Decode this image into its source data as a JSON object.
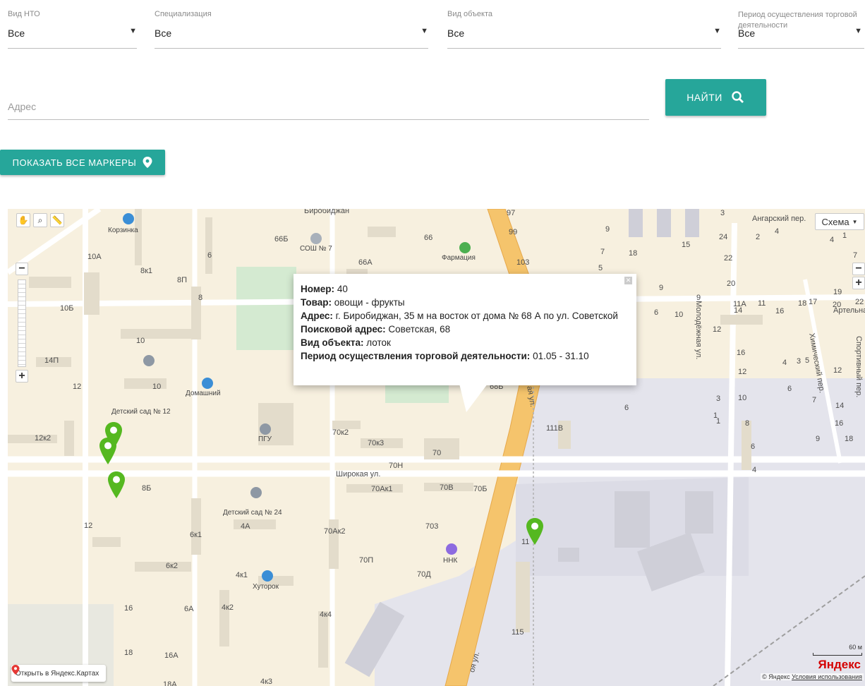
{
  "filters": [
    {
      "label": "Вид НТО",
      "value": "Все"
    },
    {
      "label": "Специализация",
      "value": "Все"
    },
    {
      "label": "Вид объекта",
      "value": "Все"
    },
    {
      "label": "Период осуществления торговой деятельности",
      "value": "Все"
    }
  ],
  "search": {
    "placeholder": "Адрес",
    "button_label": "НАЙТИ"
  },
  "show_markers_label": "ПОКАЗАТЬ ВСЕ МАРКЕРЫ",
  "map": {
    "type_selector": "Схема",
    "open_in_yandex": "Открыть в Яндекс.Картах",
    "logo": "Яндекс",
    "copyright": "© Яндекс",
    "terms": "Условия использования",
    "scale": "60 м",
    "balloon": {
      "number_label": "Номер:",
      "number": "40",
      "goods_label": "Товар:",
      "goods": "овощи - фрукты",
      "address_label": "Адрес:",
      "address": "г. Биробиджан, 35 м на восток от дома № 68 А по ул. Советской",
      "search_label": "Поисковой адрес:",
      "search_address": "Советская, 68",
      "object_label": "Вид объекта:",
      "object": "лоток",
      "period_label": "Период осуществления торговой деятельности:",
      "period": "01.05 - 31.10"
    },
    "pois": [
      "Корзинка",
      "СОШ № 7",
      "Фармация",
      "Домашний",
      "Детский сад № 12",
      "ПГУ",
      "Детский сад № 24",
      "ННК",
      "Хуторок"
    ],
    "streets": [
      "Широкая ул.",
      "Ангарский пер.",
      "Молодёжная ул.",
      "Химический пер.",
      "Спортивный пер.",
      "Артельная",
      "Биробиджан",
      "ая ул.",
      "оя ул."
    ],
    "house_numbers": [
      "66Б",
      "66",
      "66А",
      "97",
      "99",
      "103",
      "9",
      "7",
      "5",
      "18",
      "15",
      "24",
      "3",
      "2",
      "4",
      "4",
      "1",
      "5",
      "7",
      "10А",
      "8к1",
      "8П",
      "6",
      "8",
      "10Б",
      "10",
      "14П",
      "12",
      "12к2",
      "10",
      "70к2",
      "70к3",
      "70",
      "70Н",
      "70Ак1",
      "70В",
      "70Б",
      "8Б",
      "4А",
      "12",
      "6к1",
      "70Ак2",
      "703",
      "70П",
      "70Д",
      "11",
      "6к2",
      "4к1",
      "4к2",
      "4к4",
      "16",
      "6А",
      "18",
      "16А",
      "18А",
      "4к3",
      "115",
      "111В",
      "68Б",
      "22",
      "20",
      "11А",
      "11",
      "17",
      "19",
      "14",
      "16",
      "18",
      "20",
      "12",
      "16",
      "4",
      "3",
      "12",
      "5",
      "6",
      "7",
      "12",
      "10",
      "14",
      "8",
      "16",
      "9",
      "18",
      "1",
      "6",
      "4",
      "6",
      "10",
      "3",
      "1",
      "6",
      "9",
      "9",
      "12",
      "22"
    ]
  }
}
